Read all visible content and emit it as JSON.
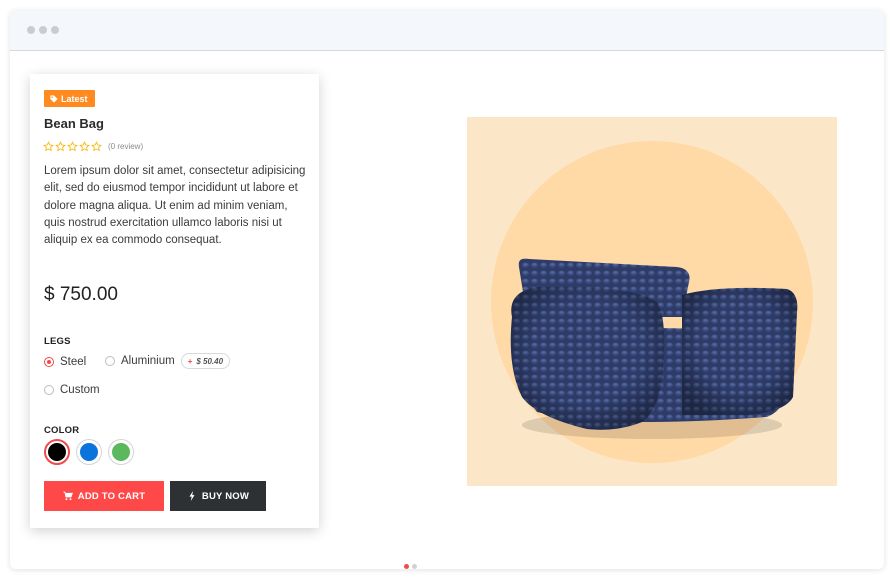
{
  "product": {
    "badge": "Latest",
    "title": "Bean Bag",
    "rating": {
      "stars": 0,
      "max": 5,
      "review_text": "(0 review)"
    },
    "description": "Lorem ipsum dolor sit amet, consectetur adipisicing elit, sed do eiusmod tempor incididunt ut labore et dolore magna aliqua. Ut enim ad minim veniam, quis nostrud exercitation ullamco laboris nisi ut aliquip ex ea commodo consequat.",
    "price": "$ 750.00"
  },
  "legs": {
    "label": "LEGS",
    "options": [
      {
        "label": "Steel",
        "selected": true
      },
      {
        "label": "Aluminium",
        "selected": false,
        "extra_plus": "+",
        "extra_price": "$ 50.40"
      },
      {
        "label": "Custom",
        "selected": false
      }
    ]
  },
  "color": {
    "label": "COLOR",
    "options": [
      {
        "name": "black",
        "hex": "#000000",
        "selected": true
      },
      {
        "name": "blue",
        "hex": "#0a73dc",
        "selected": false
      },
      {
        "name": "green",
        "hex": "#5cb85c",
        "selected": false
      }
    ]
  },
  "buttons": {
    "add_to_cart": "ADD TO CART",
    "buy_now": "BUY NOW"
  },
  "image": {
    "background_color": "#fbe7c8",
    "circle_color": "#ffd9a6",
    "product_color": "#2d3b66"
  },
  "carousel": {
    "count": 2,
    "active_index": 0
  },
  "colors": {
    "accent": "#f04a4a",
    "badge": "#ff8a1f",
    "buy_button": "#2e3134"
  }
}
